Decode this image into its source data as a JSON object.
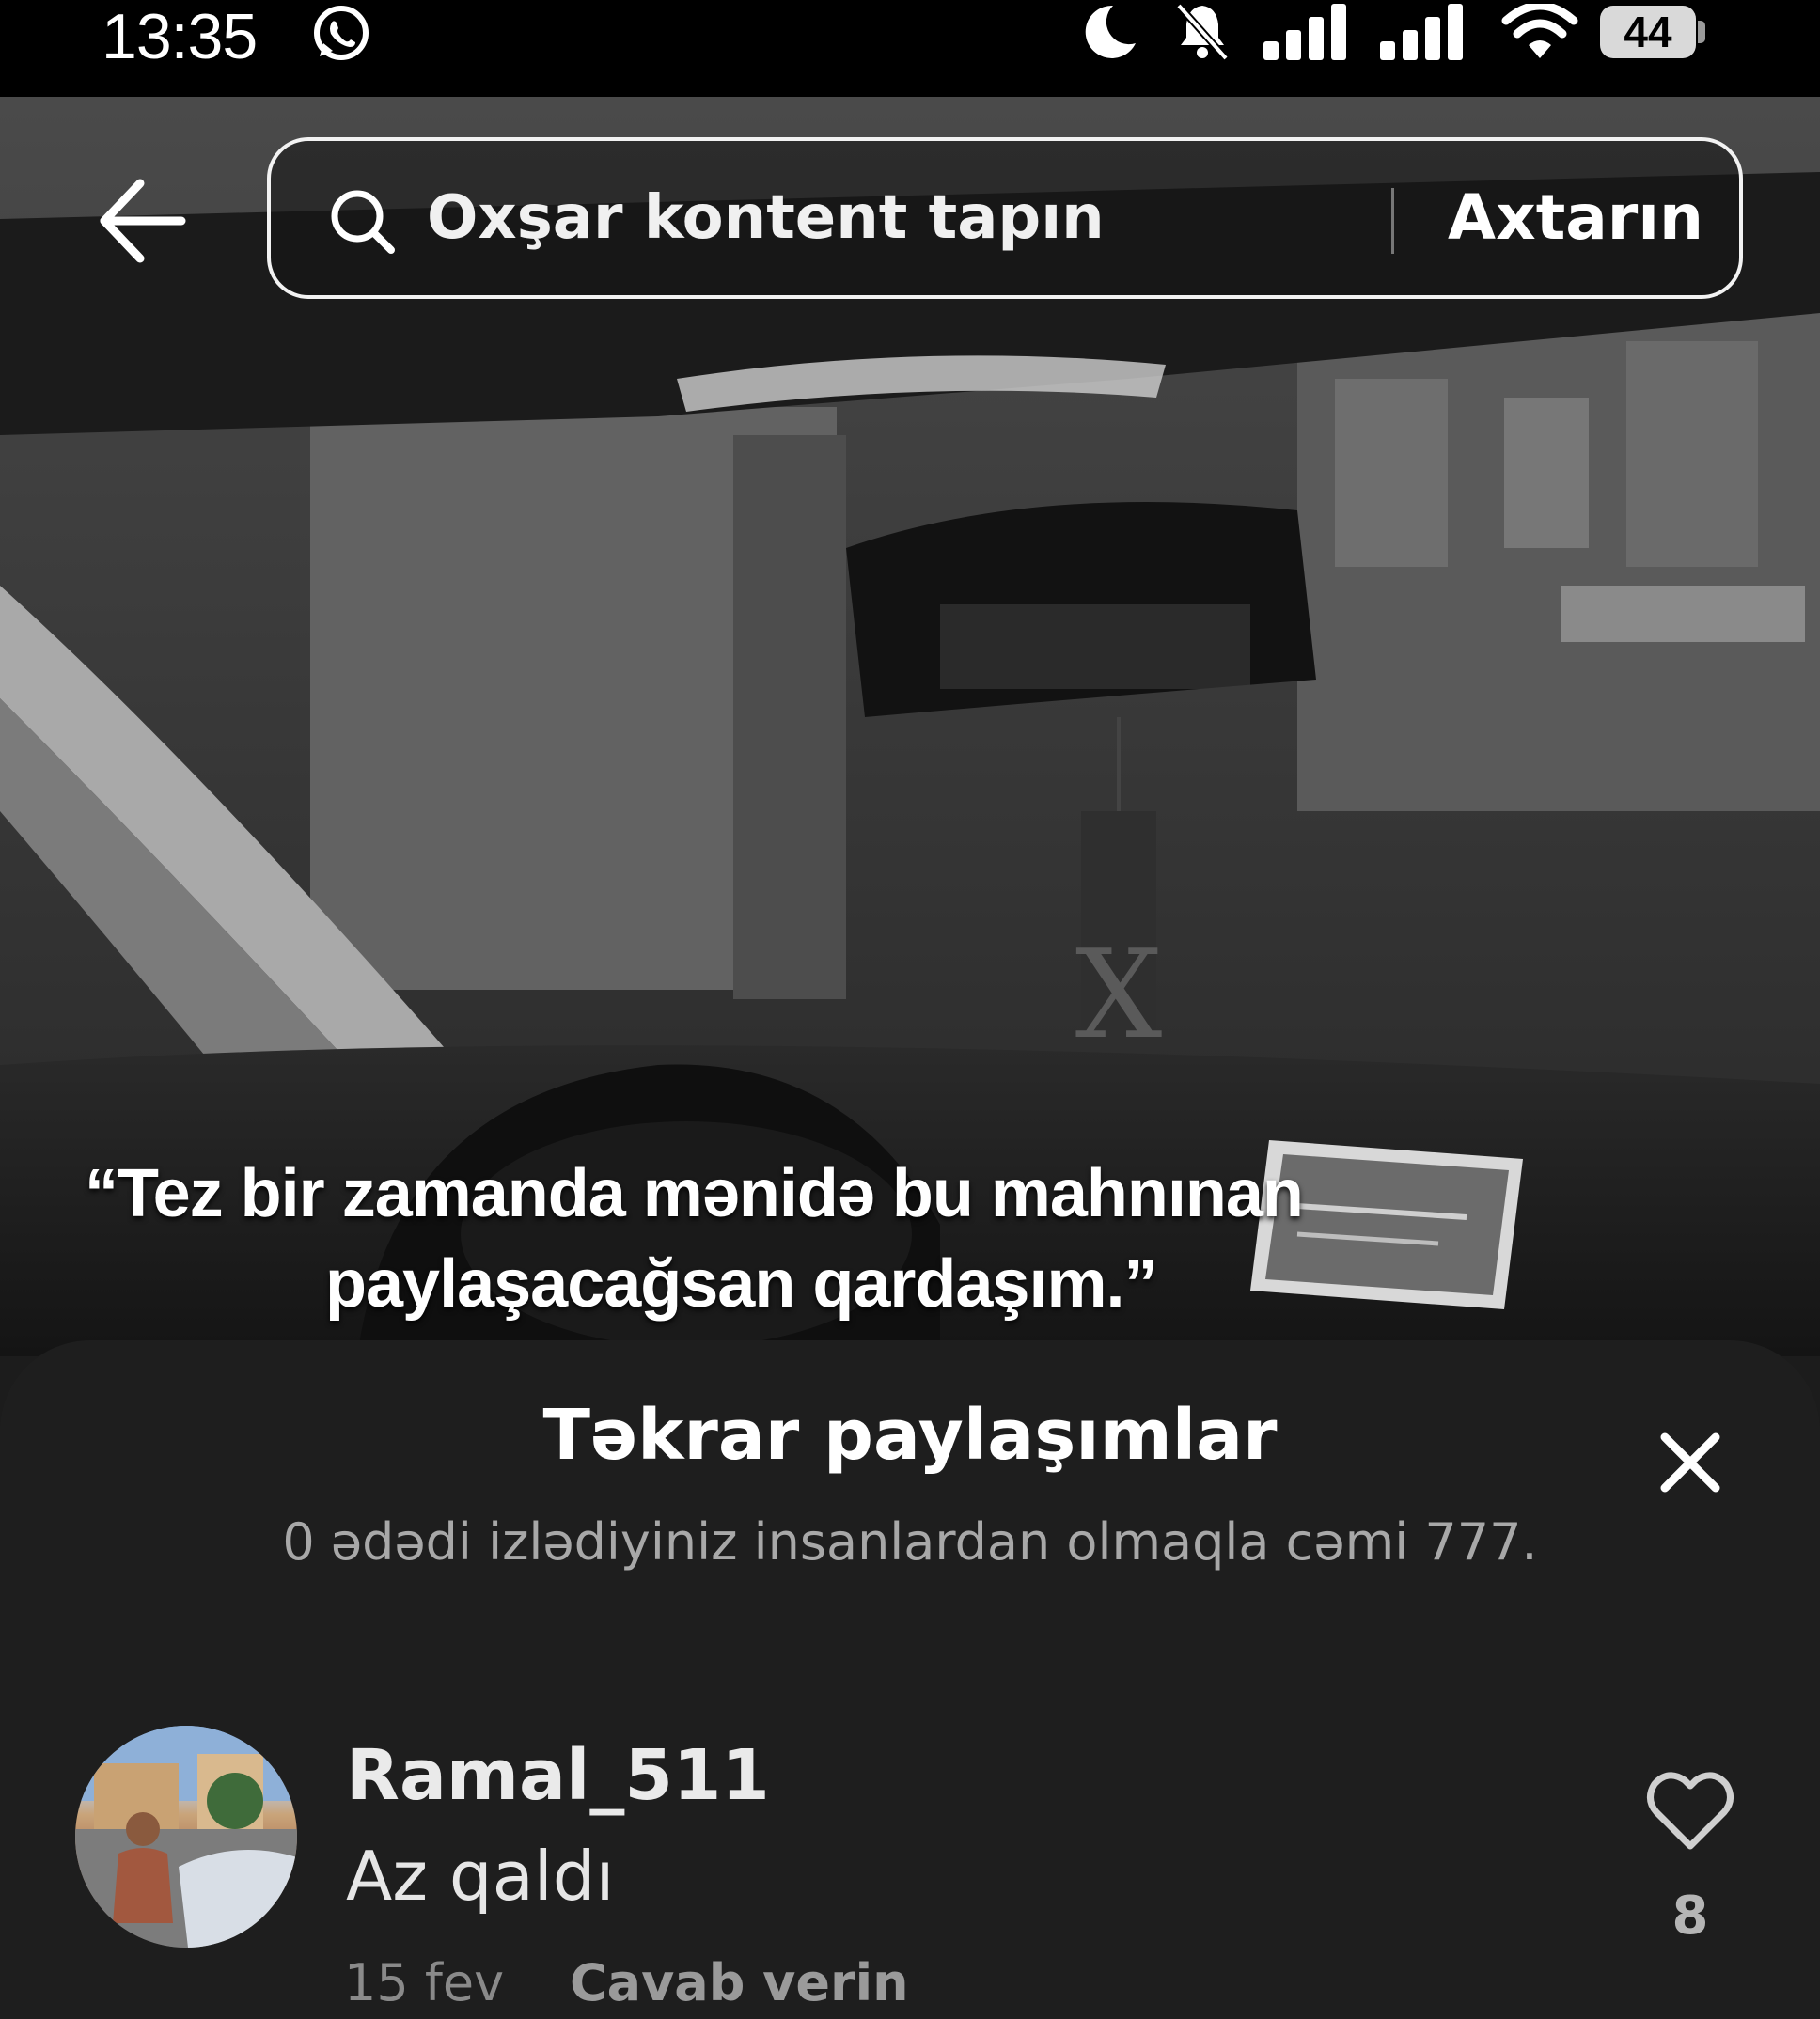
{
  "status_bar": {
    "time": "13:35",
    "battery": "44",
    "icons": [
      "whatsapp-icon",
      "moon-icon",
      "bell-off-icon",
      "signal-icon",
      "signal-icon",
      "wifi-icon",
      "battery-icon"
    ]
  },
  "search": {
    "placeholder": "Oxşar kontent tapın",
    "submit_label": "Axtarın"
  },
  "video": {
    "caption_line1": "“Tez bir zamanda mənidə bu mahnınan",
    "caption_line2": "paylaşacağsan qardaşım.”"
  },
  "sheet": {
    "title": "Təkrar paylaşımlar",
    "subtitle": "0 ədədi izlədiyiniz insanlardan olmaqla cəmi 777.",
    "comments": [
      {
        "username": "Ramal_511",
        "text": "Az qaldı",
        "date": "15 fev",
        "reply_label": "Cavab verin",
        "likes": "8"
      }
    ]
  },
  "colors": {
    "sheet_background": "#1e1e1e",
    "status_background": "#000000",
    "muted_text": "#a8a8a8"
  }
}
